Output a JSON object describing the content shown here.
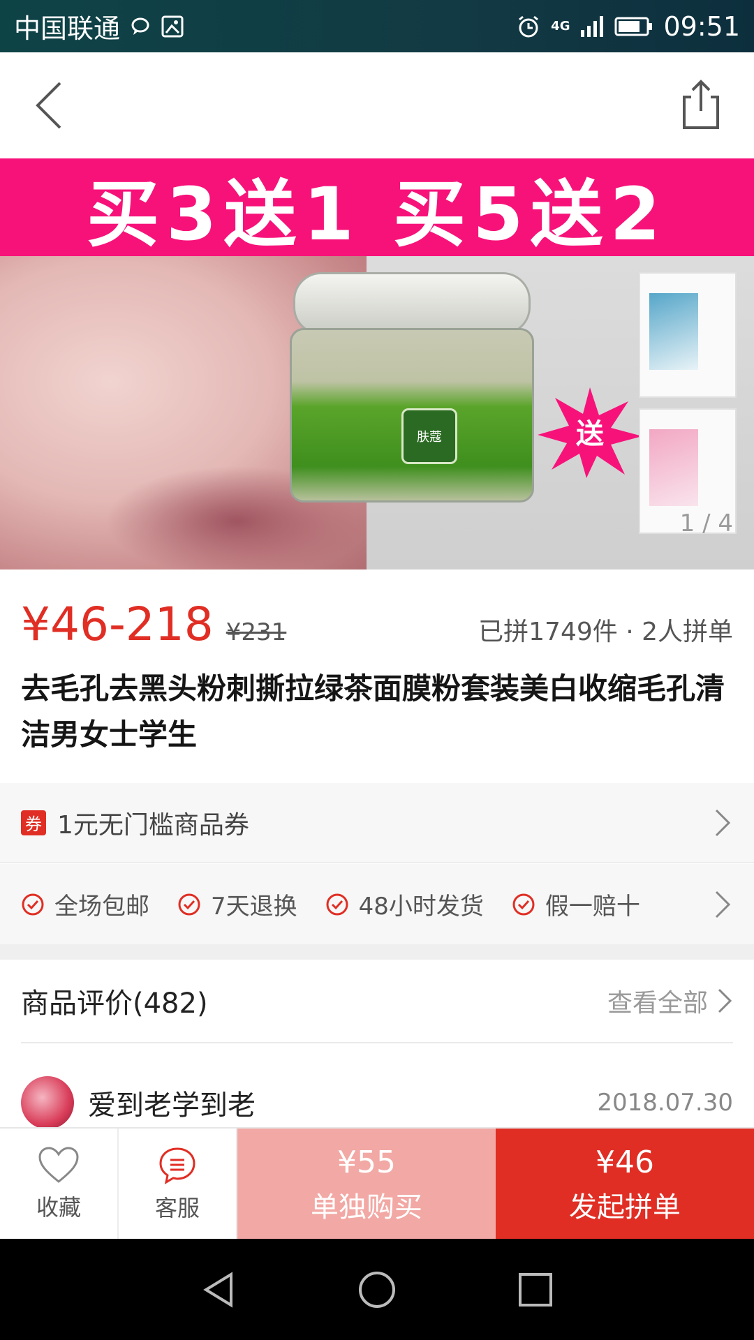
{
  "status_bar": {
    "carrier": "中国联通",
    "network": "4G",
    "time": "09:51"
  },
  "nav": {
    "back_icon": "chevron-left-icon",
    "share_icon": "share-icon"
  },
  "hero": {
    "promo_text": "买3送1  买5送2",
    "gift_label": "送",
    "brand_label": "肤蔻",
    "page_indicator": "1 / 4"
  },
  "product": {
    "price": "¥46-218",
    "original_price": "¥231",
    "sold_info": "已拼1749件 · 2人拼单",
    "title": "去毛孔去黑头粉刺撕拉绿茶面膜粉套装美白收缩毛孔清洁男女士学生"
  },
  "coupon": {
    "badge": "券",
    "text": "1元无门槛商品券"
  },
  "services": [
    {
      "label": "全场包邮"
    },
    {
      "label": "7天退换"
    },
    {
      "label": "48小时发货"
    },
    {
      "label": "假一赔十"
    }
  ],
  "reviews": {
    "title": "商品评价(482)",
    "view_all": "查看全部",
    "first": {
      "name": "爱到老学到老",
      "date": "2018.07.30"
    }
  },
  "bottom_bar": {
    "favorite_label": "收藏",
    "service_label": "客服",
    "buy_alone_price": "¥55",
    "buy_alone_label": "单独购买",
    "group_price": "¥46",
    "group_label": "发起拼单"
  },
  "colors": {
    "accent": "#e02e24",
    "buy_alone_bg": "#f2a8a4",
    "promo_banner": "#f7127a"
  }
}
